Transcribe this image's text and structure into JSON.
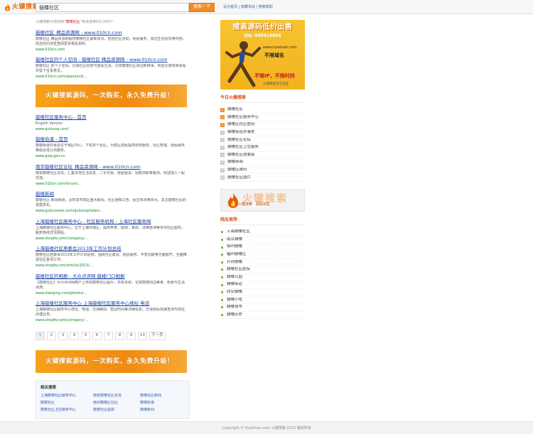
{
  "header": {
    "logo_text": "火键搜索",
    "search_value": "鼓楼社区",
    "search_button": "搜索一下",
    "links": "设为首页 | 收藏本站 | 搜索帮助"
  },
  "results": {
    "stats_prefix": "火键搜索为您找到“",
    "stats_keyword": "鼓楼社区",
    "stats_suffix": "”相关结果约1,000个",
    "items": [
      {
        "title": "鼓楼社区_精品资源网 - www.010cn.com",
        "snippet": "鼓楼社区 精品资源网提供鼓楼社区最新资讯，包括社区活动、便民服务、周边生活信息等内容，欢迎访问浏览查阅更多相关资料。",
        "url": "www.010cn.com"
      },
      {
        "title": "鼓楼社区的个人空间 - 鼓楼社区 精品资源网 - www.010cn.com",
        "snippet": "鼓楼社区 的个人空间，记录社区动态与居民生活，分享鼓楼社区周边新鲜事，欢迎大家常来看看并留下宝贵意见。",
        "url": "www.010cn.com/space/uid..."
      },
      {
        "title": "鼓楼社区服务中心 - 首页",
        "snippet": "English Version",
        "url": "www.gulousq.com/"
      },
      {
        "title": "鼓楼街道 - 首页",
        "snippet": "鼓楼街道办事处位于城区中心，下辖多个社区，为辖区居民提供政务服务、社区管理、便民服务等综合性公共服务。",
        "url": "www.glsq.gov.cn"
      },
      {
        "title": "南京鼓楼社区论坛_精品资源网 - www.010cn.com",
        "snippet": "南京鼓楼社区论坛，汇集本地生活信息、二手交易、房屋租赁、招聘求职等板块，欢迎加入一起交流。",
        "url": "www.010cn.com/forum/..."
      },
      {
        "title": "鼓楼新闻",
        "snippet": "鼓楼社区 新闻频道，及时发布辖区重大新闻、社区通知公告、民生热点等资讯，关注鼓楼社区的发展变化。",
        "url": "www.gulounews.com/gulousq/news/..."
      },
      {
        "title": "上海鼓楼社区服务中心 - 社区服务机构 - 上海社区服务网",
        "snippet": "上海鼓楼社区服务中心，位于上海市城区，提供养老、助残、家政、法律咨询等多项社区服务，服务热线详见网站。",
        "url": "www.shsqfw.com/company/..."
      },
      {
        "title": "上海鼓楼社区居委会2013年工作计划总结",
        "snippet": "鼓楼社区居委会2013年工作计划总结，围绕社区建设、居民服务、平安创建等方面展开，全面推进社区各项工作。",
        "url": "www.shsqfw.com/article/2013/..."
      },
      {
        "title": "鼓楼社区的相册 - 大众点评网 鼓楼门口相册",
        "snippet": "【鼓楼社区】大众点评网用户上传的鼓楼社区图片，共有多张，记录鼓楼周边美食、街景与生活点滴。",
        "url": "www.dianping.com/photos/..."
      },
      {
        "title": "上海鼓楼社区服务中心 上海鼓楼社区服务中心地址 电话",
        "snippet": "上海鼓楼社区服务中心地址、电话、交通路线、营业时间等详细信息，方便居民快速查询与前往办理业务。",
        "url": "www.shsqfw.com/company/..."
      }
    ],
    "banner_text": "火键搜索源码，一次购买，永久免费升级！",
    "pages": [
      "1",
      "2",
      "3",
      "4",
      "5",
      "6",
      "7",
      "8",
      "9",
      "10",
      "下一页"
    ]
  },
  "related": {
    "title": "相关搜索",
    "links": [
      "上海鼓楼社区服务中心",
      "南京鼓楼社区论坛",
      "鼓楼社区新闻",
      "鼓楼社区",
      "徐州鼓楼区社区",
      "鼓楼街道",
      "鼓楼社区卫生服务中心",
      "鼓楼社区医院",
      "鼓楼新闻"
    ]
  },
  "sidebar": {
    "ad": {
      "headline": "搜索源码低价出售",
      "qq": "QQ: 909516866",
      "domain": "www.huoduan.com",
      "unlimited": "不限域名",
      "ip": "不限IP，不限时间",
      "foot": "火键搜索官方出品"
    },
    "hot_heading": "今日火爆搜索",
    "hot_items": [
      "鼓楼社区",
      "鼓楼社区服务中心",
      "鼓楼区社区医院",
      "鼓楼街道办事处",
      "鼓楼社区论坛",
      "鼓楼社区卫生服务",
      "鼓楼社区居委会",
      "鼓楼新闻",
      "鼓楼区政府",
      "鼓楼社区图片"
    ],
    "ad2_caption": "火键搜索 · 源码出售",
    "ad2_bg": "火键搜索",
    "rec_heading": "网友推荐",
    "rec_items": [
      "上海鼓楼社区",
      "南京鼓楼",
      "徐州鼓楼",
      "福州鼓楼区",
      "开封鼓楼",
      "鼓楼社区医院",
      "鼓楼公园",
      "鼓楼街道",
      "西安鼓楼",
      "鼓楼小吃",
      "鼓楼夜市",
      "鼓楼历史"
    ]
  },
  "footer": {
    "text": "Copyright © HuoDuan.com 火键搜索 2013 版权所有"
  }
}
